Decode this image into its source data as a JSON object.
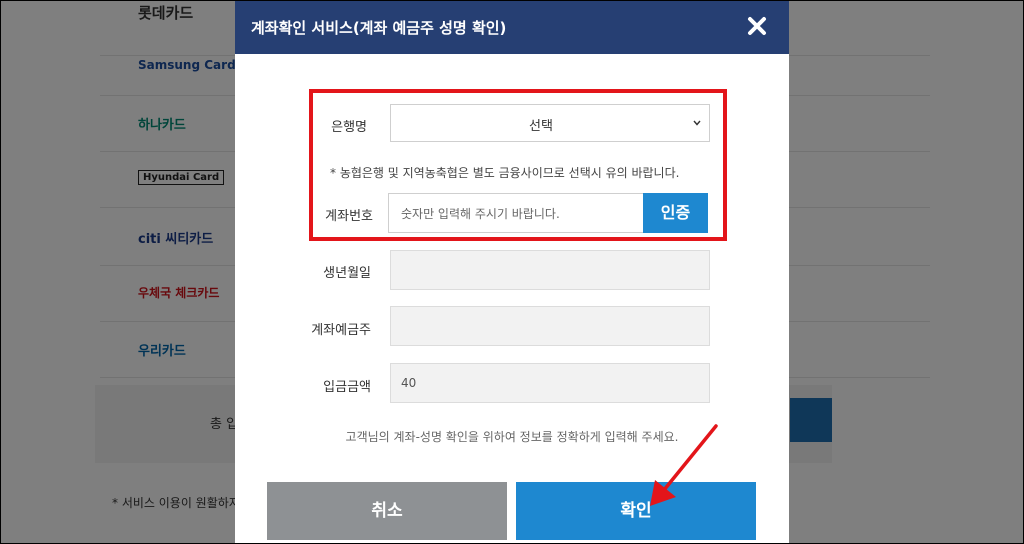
{
  "background": {
    "card_brands": [
      "롯데카드",
      "Samsung Card",
      "하나카드",
      "Hyundai Card",
      "citi 씨티카드",
      "우체국 체크카드",
      "우리카드"
    ],
    "total_label": "총 입",
    "service_note": "* 서비스 이용이 원활하지"
  },
  "modal": {
    "title": "계좌확인 서비스(계좌 예금주 성명 확인)",
    "close_icon": "close-icon",
    "bank": {
      "label": "은행명",
      "selected": "선택"
    },
    "notice": "* 농협은행 및 지역농축협은 별도 금융사이므로 선택시 유의 바랍니다.",
    "account": {
      "label": "계좌번호",
      "placeholder": "숫자만 입력해 주시기 바랍니다.",
      "verify_label": "인증"
    },
    "birth": {
      "label": "생년월일",
      "value": ""
    },
    "holder": {
      "label": "계좌예금주",
      "value": ""
    },
    "amount": {
      "label": "입금금액",
      "value": "40"
    },
    "guide": "고객님의 계좌-성명 확인을 위하여 정보를 정확하게 입력해 주세요.",
    "cancel_label": "취소",
    "confirm_label": "확인"
  },
  "annotation": {
    "highlight_color": "#e3151a",
    "arrow_color": "#e3151a"
  },
  "colors": {
    "header": "#263f73",
    "primary": "#1e88d0",
    "cancel": "#8e9194"
  }
}
